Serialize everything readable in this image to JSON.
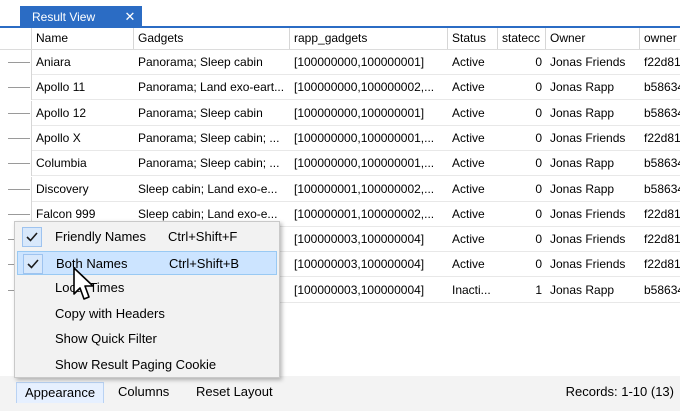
{
  "tab": {
    "title": "Result View",
    "close_glyph": "✕"
  },
  "grid": {
    "columns": [
      {
        "key": "name",
        "label": "Name"
      },
      {
        "key": "gadgets",
        "label": "Gadgets"
      },
      {
        "key": "rapp",
        "label": "rapp_gadgets"
      },
      {
        "key": "status",
        "label": "Status"
      },
      {
        "key": "statecode",
        "label": "statecc"
      },
      {
        "key": "owner",
        "label": "Owner"
      },
      {
        "key": "ownerid",
        "label": "owner"
      }
    ],
    "rows": [
      [
        "Aniara",
        "Panorama; Sleep cabin",
        "[100000000,100000001]",
        "Active",
        "0",
        "Jonas Friends",
        "f22d81"
      ],
      [
        "Apollo 11",
        "Panorama; Land exo-eart...",
        "[100000000,100000002,...",
        "Active",
        "0",
        "Jonas Rapp",
        "b58634"
      ],
      [
        "Apollo 12",
        "Panorama; Sleep cabin",
        "[100000000,100000001]",
        "Active",
        "0",
        "Jonas Rapp",
        "b58634"
      ],
      [
        "Apollo X",
        "Panorama; Sleep cabin; ...",
        "[100000000,100000001,...",
        "Active",
        "0",
        "Jonas Friends",
        "f22d81"
      ],
      [
        "Columbia",
        "Panorama; Sleep cabin; ...",
        "[100000000,100000001,...",
        "Active",
        "0",
        "Jonas Rapp",
        "b58634"
      ],
      [
        "Discovery",
        "Sleep cabin; Land exo-e...",
        "[100000001,100000002,...",
        "Active",
        "0",
        "Jonas Rapp",
        "b58634"
      ],
      [
        "Falcon 999",
        "Sleep cabin; Land exo-e...",
        "[100000001,100000002,...",
        "Active",
        "0",
        "Jonas Friends",
        "f22d81"
      ],
      [
        "",
        "",
        "[100000003,100000004]",
        "Active",
        "0",
        "Jonas Friends",
        "f22d81"
      ],
      [
        "",
        "",
        "[100000003,100000004]",
        "Active",
        "0",
        "Jonas Friends",
        "f22d81"
      ],
      [
        "",
        "",
        "[100000003,100000004]",
        "Inacti...",
        "1",
        "Jonas Rapp",
        "b58634"
      ]
    ]
  },
  "context_menu": {
    "items": [
      {
        "label": "Friendly Names",
        "shortcut": "Ctrl+Shift+F",
        "checked": true
      },
      {
        "label": "Both Names",
        "shortcut": "Ctrl+Shift+B",
        "checked": true,
        "hover": true
      },
      {
        "label": "Local Times",
        "shortcut": "",
        "checked": false
      },
      {
        "label": "Copy with Headers",
        "shortcut": "",
        "checked": false
      },
      {
        "label": "Show Quick Filter",
        "shortcut": "",
        "checked": false
      },
      {
        "label": "Show Result Paging Cookie",
        "shortcut": "",
        "checked": false
      }
    ]
  },
  "bottom_bar": {
    "appearance_label": "Appearance",
    "columns_label": "Columns",
    "reset_label": "Reset Layout",
    "records_text": "Records: 1-10 (13)"
  },
  "colors": {
    "accent": "#2b6cc4",
    "menu_hover": "#cce4ff",
    "check_bg": "#d8e8fb"
  },
  "icons": {
    "check": "check-icon",
    "close": "close-icon",
    "cursor": "mouse-pointer-icon"
  }
}
